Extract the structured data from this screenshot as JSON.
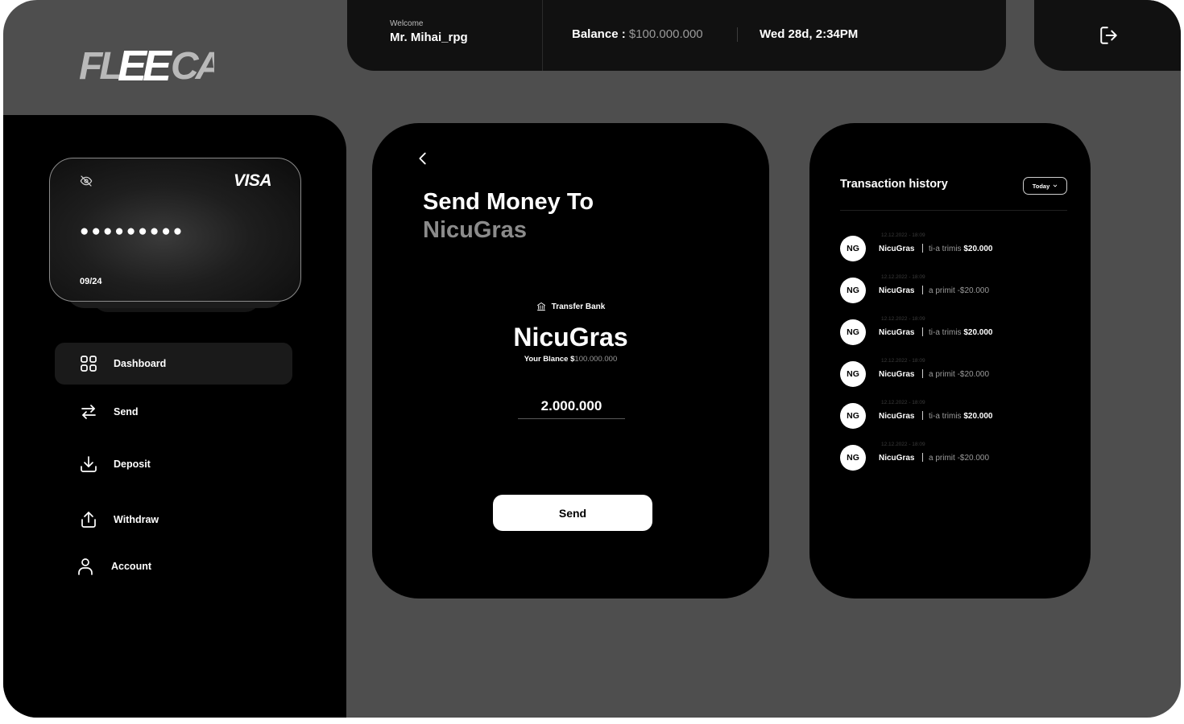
{
  "brand": {
    "logo_text": "FLEECA"
  },
  "header": {
    "welcome_label": "Welcome",
    "user_name": "Mr. Mihai_rpg",
    "balance_label": "Balance :",
    "balance_value": "$100.000.000",
    "datetime": "Wed 28d, 2:34PM"
  },
  "card": {
    "network": "VISA",
    "masked_number": "●●●●●●●●●",
    "expiry": "09/24"
  },
  "nav": {
    "items": [
      {
        "label": "Dashboard",
        "icon": "grid-icon"
      },
      {
        "label": "Send",
        "icon": "swap-arrows-icon"
      },
      {
        "label": "Deposit",
        "icon": "download-icon"
      },
      {
        "label": "Withdraw",
        "icon": "upload-icon"
      },
      {
        "label": "Account",
        "icon": "user-icon"
      }
    ]
  },
  "send": {
    "title": "Send Money To",
    "recipient": "NicuGras",
    "method_label": "Transfer Bank",
    "recipient_big": "NicuGras",
    "your_balance_label": "Your Blance",
    "your_balance_currency": "$",
    "your_balance_value": "100.000.000",
    "amount": "2.000.000",
    "button_label": "Send"
  },
  "transactions": {
    "title": "Transaction history",
    "filter_label": "Today",
    "items": [
      {
        "initials": "NG",
        "date": "12.12.2022 - 18:09",
        "name": "NicuGras",
        "action": "ti-a trimis",
        "amount": "$20.000"
      },
      {
        "initials": "NG",
        "date": "12.12.2022 - 18:09",
        "name": "NicuGras",
        "action": "a primit",
        "amount": "-$20.000"
      },
      {
        "initials": "NG",
        "date": "12.12.2022 - 18:09",
        "name": "NicuGras",
        "action": "ti-a trimis",
        "amount": "$20.000"
      },
      {
        "initials": "NG",
        "date": "12.12.2022 - 18:09",
        "name": "NicuGras",
        "action": "a primit",
        "amount": "-$20.000"
      },
      {
        "initials": "NG",
        "date": "12.12.2022 - 18:09",
        "name": "NicuGras",
        "action": "ti-a trimis",
        "amount": "$20.000"
      },
      {
        "initials": "NG",
        "date": "12.12.2022 - 18:09",
        "name": "NicuGras",
        "action": "a primit",
        "amount": "-$20.000"
      }
    ]
  },
  "colors": {
    "background": "#4e4e4e",
    "panel": "#000000",
    "topbar": "#111111",
    "muted_text": "#9a9a9a",
    "accent": "#ffffff"
  }
}
